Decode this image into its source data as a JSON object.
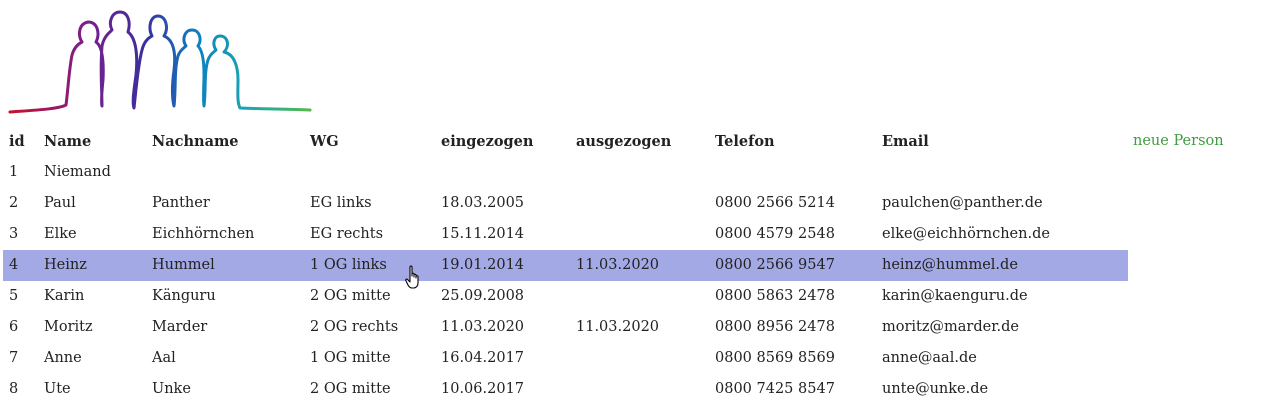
{
  "colors": {
    "selected_row": "#a3a9e5",
    "new_person_link": "#3f9c3f",
    "logo_gradient": [
      "#c8102e",
      "#7a1f8a",
      "#3a2f9e",
      "#0e7fc1",
      "#1aa8b0",
      "#55b84a"
    ]
  },
  "logo": {
    "icon": "people-silhouettes-logo"
  },
  "table": {
    "headers": [
      "id",
      "Name",
      "Nachname",
      "WG",
      "eingezogen",
      "ausgezogen",
      "Telefon",
      "Email"
    ],
    "rows": [
      [
        "1",
        "Niemand",
        "",
        "",
        "",
        "",
        "",
        ""
      ],
      [
        "2",
        "Paul",
        "Panther",
        "EG links",
        "18.03.2005",
        "",
        "0800 2566 5214",
        "paulchen@panther.de"
      ],
      [
        "3",
        "Elke",
        "Eichhörnchen",
        "EG rechts",
        "15.11.2014",
        "",
        "0800 4579 2548",
        "elke@eichhörnchen.de"
      ],
      [
        "4",
        "Heinz",
        "Hummel",
        "1 OG links",
        "19.01.2014",
        "11.03.2020",
        "0800 2566 9547",
        "heinz@hummel.de"
      ],
      [
        "5",
        "Karin",
        "Känguru",
        "2 OG mitte",
        "25.09.2008",
        "",
        "0800 5863 2478",
        "karin@kaenguru.de"
      ],
      [
        "6",
        "Moritz",
        "Marder",
        "2 OG rechts",
        "11.03.2020",
        "11.03.2020",
        "0800 8956 2478",
        "moritz@marder.de"
      ],
      [
        "7",
        "Anne",
        "Aal",
        "1 OG mitte",
        "16.04.2017",
        "",
        "0800 8569 8569",
        "anne@aal.de"
      ],
      [
        "8",
        "Ute",
        "Unke",
        "2 OG mitte",
        "10.06.2017",
        "",
        "0800 7425 8547",
        "unte@unke.de"
      ]
    ],
    "selected_row": "4"
  },
  "actions": {
    "new_person_label": "neue Person"
  },
  "cursor": {
    "icon": "hand-pointer-icon"
  }
}
